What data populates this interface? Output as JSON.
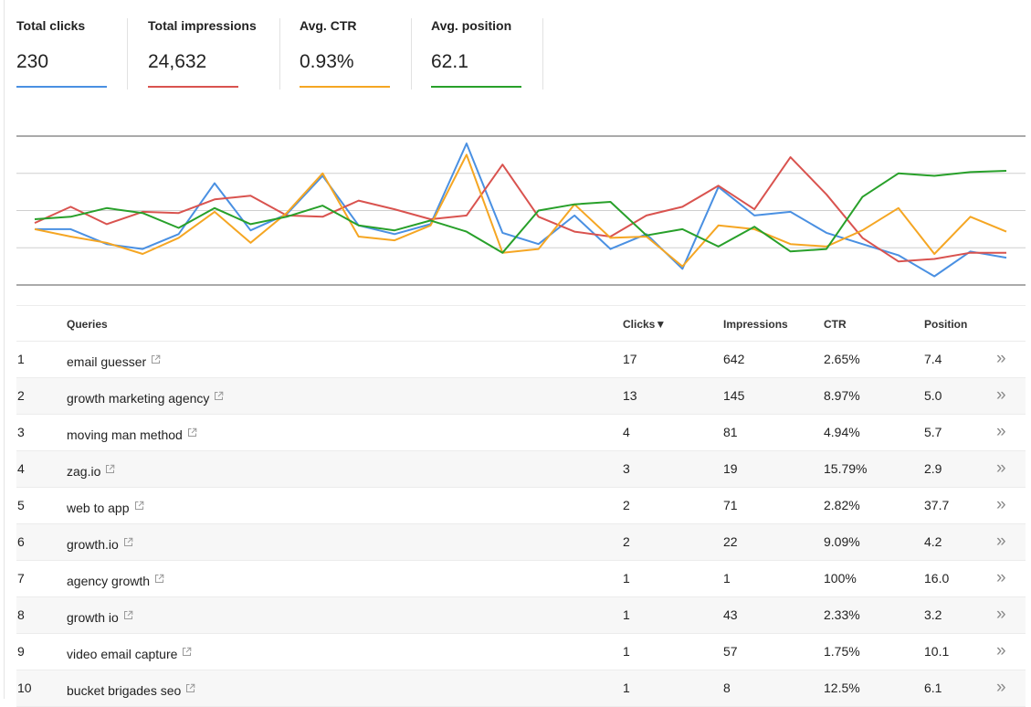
{
  "metrics": [
    {
      "label": "Total clicks",
      "value": "230",
      "color": "#4a90e2"
    },
    {
      "label": "Total impressions",
      "value": "24,632",
      "color": "#d9534f"
    },
    {
      "label": "Avg. CTR",
      "value": "0.93%",
      "color": "#f5a623"
    },
    {
      "label": "Avg. position",
      "value": "62.1",
      "color": "#28a02a"
    }
  ],
  "chart_data": {
    "type": "line",
    "grid": true,
    "gridline_count": 5,
    "series": [
      {
        "color": "#4a90e2",
        "values": [
          4.5,
          4.5,
          3.3,
          2.9,
          4.1,
          8.2,
          4.4,
          5.7,
          8.8,
          4.8,
          4.1,
          4.9,
          11.4,
          4.2,
          3.3,
          5.6,
          2.9,
          4.1,
          1.3,
          7.9,
          5.6,
          5.9,
          4.2,
          3.3,
          2.4,
          0.7,
          2.7,
          2.2
        ]
      },
      {
        "color": "#d9534f",
        "values": [
          5.0,
          6.3,
          4.9,
          5.9,
          5.8,
          6.9,
          7.2,
          5.6,
          5.5,
          6.8,
          6.1,
          5.3,
          5.6,
          9.7,
          5.5,
          4.3,
          3.9,
          5.6,
          6.3,
          8.0,
          6.1,
          10.3,
          7.3,
          3.8,
          1.9,
          2.1,
          2.6,
          2.6
        ]
      },
      {
        "color": "#f5a623",
        "values": [
          4.5,
          3.9,
          3.4,
          2.5,
          3.8,
          5.9,
          3.4,
          5.8,
          9.0,
          3.9,
          3.6,
          4.8,
          10.5,
          2.6,
          2.9,
          6.5,
          3.8,
          3.9,
          1.5,
          4.8,
          4.5,
          3.3,
          3.1,
          4.4,
          6.2,
          2.5,
          5.5,
          4.3
        ]
      },
      {
        "color": "#28a02a",
        "values": [
          5.3,
          5.5,
          6.2,
          5.8,
          4.6,
          6.2,
          4.9,
          5.5,
          6.4,
          4.8,
          4.4,
          5.2,
          4.3,
          2.6,
          6.0,
          6.5,
          6.7,
          4.0,
          4.5,
          3.1,
          4.7,
          2.7,
          2.9,
          7.1,
          9.0,
          8.8,
          9.1,
          9.2
        ]
      }
    ]
  },
  "table": {
    "headers": {
      "queries": "Queries",
      "clicks": "Clicks",
      "clicks_sort_indicator": "▼",
      "impressions": "Impressions",
      "ctr": "CTR",
      "position": "Position"
    },
    "rows": [
      {
        "num": "1",
        "query": "email guesser",
        "clicks": "17",
        "impressions": "642",
        "ctr": "2.65%",
        "position": "7.4"
      },
      {
        "num": "2",
        "query": "growth marketing agency",
        "clicks": "13",
        "impressions": "145",
        "ctr": "8.97%",
        "position": "5.0"
      },
      {
        "num": "3",
        "query": "moving man method",
        "clicks": "4",
        "impressions": "81",
        "ctr": "4.94%",
        "position": "5.7"
      },
      {
        "num": "4",
        "query": "zag.io",
        "clicks": "3",
        "impressions": "19",
        "ctr": "15.79%",
        "position": "2.9"
      },
      {
        "num": "5",
        "query": "web to app",
        "clicks": "2",
        "impressions": "71",
        "ctr": "2.82%",
        "position": "37.7"
      },
      {
        "num": "6",
        "query": "growth.io",
        "clicks": "2",
        "impressions": "22",
        "ctr": "9.09%",
        "position": "4.2"
      },
      {
        "num": "7",
        "query": "agency growth",
        "clicks": "1",
        "impressions": "1",
        "ctr": "100%",
        "position": "16.0"
      },
      {
        "num": "8",
        "query": "growth io",
        "clicks": "1",
        "impressions": "43",
        "ctr": "2.33%",
        "position": "3.2"
      },
      {
        "num": "9",
        "query": "video email capture",
        "clicks": "1",
        "impressions": "57",
        "ctr": "1.75%",
        "position": "10.1"
      },
      {
        "num": "10",
        "query": "bucket brigades seo",
        "clicks": "1",
        "impressions": "8",
        "ctr": "12.5%",
        "position": "6.1"
      }
    ],
    "row_action_glyph": "»",
    "row_action_icon": "double-chevron-right-icon",
    "query_link_icon": "external-link-icon"
  }
}
